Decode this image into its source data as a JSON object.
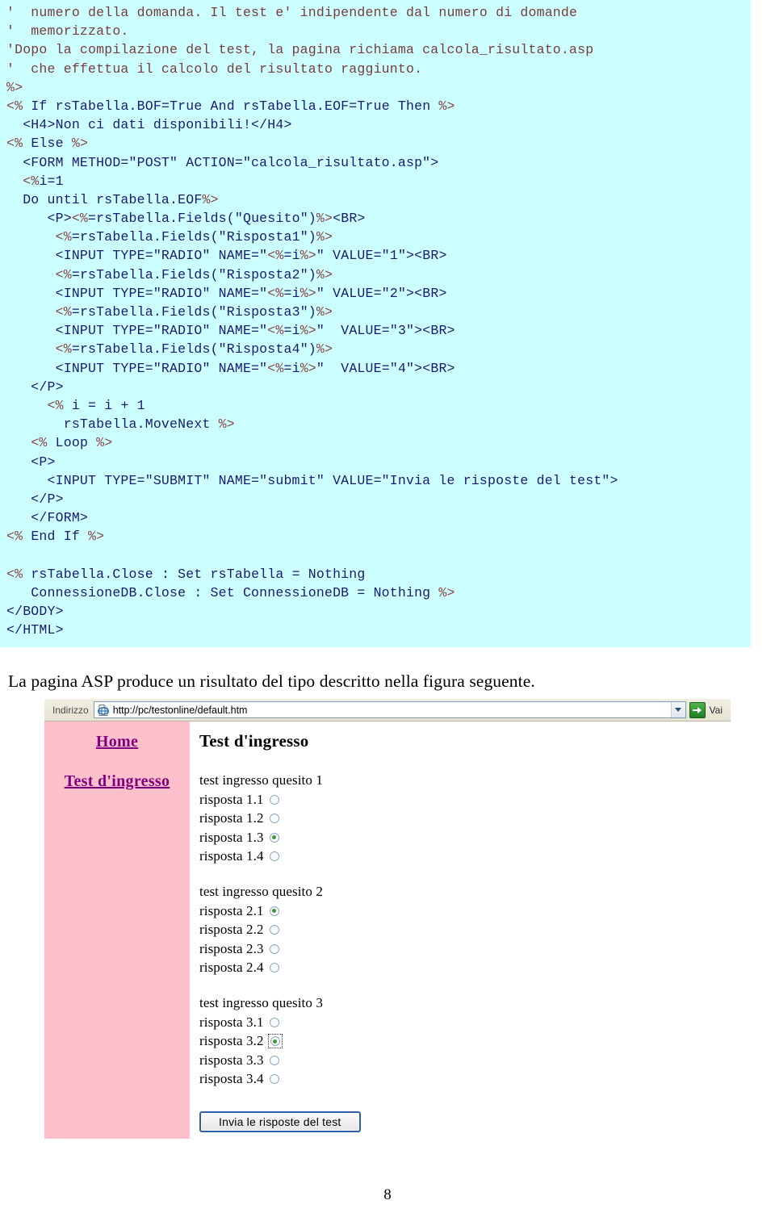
{
  "code_listing": {
    "lines": [
      "'  numero della domanda. Il test e' indipendente dal numero di domande",
      "'  memorizzato.",
      "'Dopo la compilazione del test, la pagina richiama calcola_risultato.asp",
      "'  che effettua il calcolo del risultato raggiunto.",
      "%>",
      "<% If rsTabella.BOF=True And rsTabella.EOF=True Then %>",
      "  <H4>Non ci dati disponibili!</H4>",
      "<% Else %>",
      "  <FORM METHOD=\"POST\" ACTION=\"calcola_risultato.asp\">",
      "  <%i=1",
      "  Do until rsTabella.EOF%>",
      "     <P><%=rsTabella.Fields(\"Quesito\")%><BR>",
      "      <%=rsTabella.Fields(\"Risposta1\")%>",
      "      <INPUT TYPE=\"RADIO\" NAME=\"<%=i%>\" VALUE=\"1\"><BR>",
      "      <%=rsTabella.Fields(\"Risposta2\")%>",
      "      <INPUT TYPE=\"RADIO\" NAME=\"<%=i%>\" VALUE=\"2\"><BR>",
      "      <%=rsTabella.Fields(\"Risposta3\")%>",
      "      <INPUT TYPE=\"RADIO\" NAME=\"<%=i%>\"  VALUE=\"3\"><BR>",
      "      <%=rsTabella.Fields(\"Risposta4\")%>",
      "      <INPUT TYPE=\"RADIO\" NAME=\"<%=i%>\"  VALUE=\"4\"><BR>",
      "   </P>",
      "     <% i = i + 1",
      "       rsTabella.MoveNext %>",
      "   <% Loop %>",
      "   <P>",
      "     <INPUT TYPE=\"SUBMIT\" NAME=\"submit\" VALUE=\"Invia le risposte del test\">",
      "   </P>",
      "   </FORM>",
      "<% End If %>",
      "",
      "<% rsTabella.Close : Set rsTabella = Nothing",
      "   ConnessioneDB.Close : Set ConnessioneDB = Nothing %>",
      "</BODY>",
      "</HTML>"
    ]
  },
  "figure_caption": "La pagina ASP produce un risultato del tipo descritto nella figura seguente.",
  "browser": {
    "address_label": "Indirizzo",
    "address_value": "http://pc/testonline/default.htm",
    "go_label": "Vai",
    "sidebar": {
      "links": [
        {
          "label": "Home"
        },
        {
          "label": "Test d'ingresso"
        }
      ]
    },
    "content": {
      "heading": "Test d'ingresso",
      "questions": [
        {
          "text": "test ingresso quesito 1",
          "answers": [
            {
              "label": "risposta 1.1",
              "checked": false,
              "focused": false
            },
            {
              "label": "risposta 1.2",
              "checked": false,
              "focused": false
            },
            {
              "label": "risposta 1.3",
              "checked": true,
              "focused": false
            },
            {
              "label": "risposta 1.4",
              "checked": false,
              "focused": false
            }
          ]
        },
        {
          "text": "test ingresso quesito 2",
          "answers": [
            {
              "label": "risposta 2.1",
              "checked": true,
              "focused": false
            },
            {
              "label": "risposta 2.2",
              "checked": false,
              "focused": false
            },
            {
              "label": "risposta 2.3",
              "checked": false,
              "focused": false
            },
            {
              "label": "risposta 2.4",
              "checked": false,
              "focused": false
            }
          ]
        },
        {
          "text": "test ingresso quesito 3",
          "answers": [
            {
              "label": "risposta 3.1",
              "checked": false,
              "focused": false
            },
            {
              "label": "risposta 3.2",
              "checked": true,
              "focused": true
            },
            {
              "label": "risposta 3.3",
              "checked": false,
              "focused": false
            },
            {
              "label": "risposta 3.4",
              "checked": false,
              "focused": false
            }
          ]
        }
      ],
      "submit_label": "Invia le risposte del test"
    }
  },
  "page_number": "8",
  "colors": {
    "code_background": "#ccffff",
    "code_text": "#1a1a6e",
    "code_comment": "#7a3b3b",
    "sidebar_background": "#ffc0cb",
    "link_color": "#800080",
    "radio_dot": "#3a9a3a",
    "go_button_green": "#1d7b22"
  }
}
